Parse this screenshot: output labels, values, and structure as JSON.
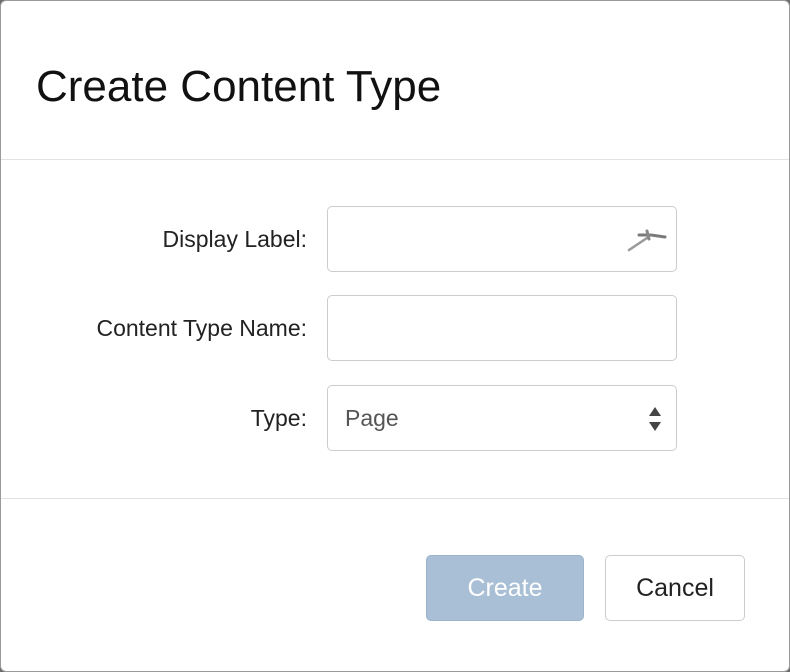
{
  "dialog": {
    "title": "Create Content Type"
  },
  "form": {
    "display_label": {
      "label": "Display Label:",
      "value": "",
      "placeholder": ""
    },
    "content_type_name": {
      "label": "Content Type Name:",
      "value": "",
      "placeholder": ""
    },
    "type": {
      "label": "Type:",
      "selected": "Page"
    }
  },
  "footer": {
    "create_label": "Create",
    "cancel_label": "Cancel"
  },
  "colors": {
    "create_button_bg": "#a9bfd6",
    "text": "#222222",
    "border": "#cccccc"
  },
  "icons": {
    "display_label_field": "wrench-tool-icon",
    "type_select": "sort-arrows-icon"
  }
}
